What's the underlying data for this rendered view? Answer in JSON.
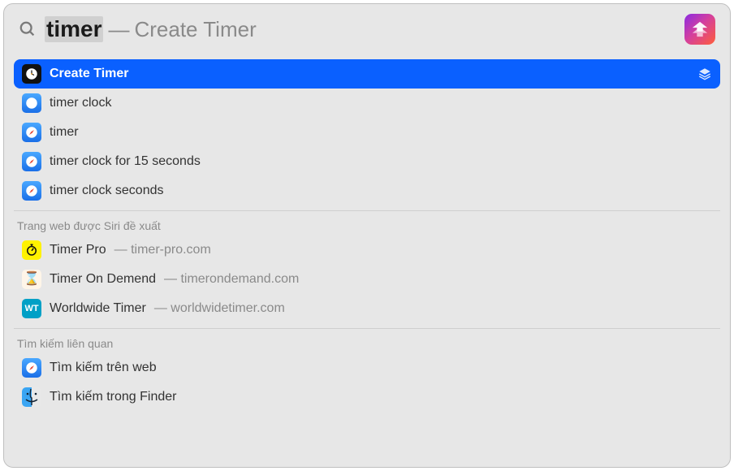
{
  "search": {
    "query": "timer",
    "dash": "—",
    "suggestion": "Create Timer"
  },
  "top_hit": {
    "title": "Create Timer"
  },
  "suggestions": [
    {
      "title": "timer clock"
    },
    {
      "title": "timer"
    },
    {
      "title": "timer clock for 15 seconds"
    },
    {
      "title": "timer clock seconds"
    }
  ],
  "sections": {
    "siri_web_header": "Trang web được Siri đề xuất",
    "related_header": "Tìm kiếm liên quan"
  },
  "siri_web": [
    {
      "title": "Timer Pro",
      "sub": "— timer-pro.com",
      "icon": "stopwatch"
    },
    {
      "title": "Timer On Demend",
      "sub": "— timerondemand.com",
      "icon": "hourglass"
    },
    {
      "title": "Worldwide Timer",
      "sub": "— worldwidetimer.com",
      "icon": "wt"
    }
  ],
  "related": [
    {
      "title": "Tìm kiếm trên web",
      "icon": "safari"
    },
    {
      "title": "Tìm kiếm trong Finder",
      "icon": "finder"
    }
  ]
}
